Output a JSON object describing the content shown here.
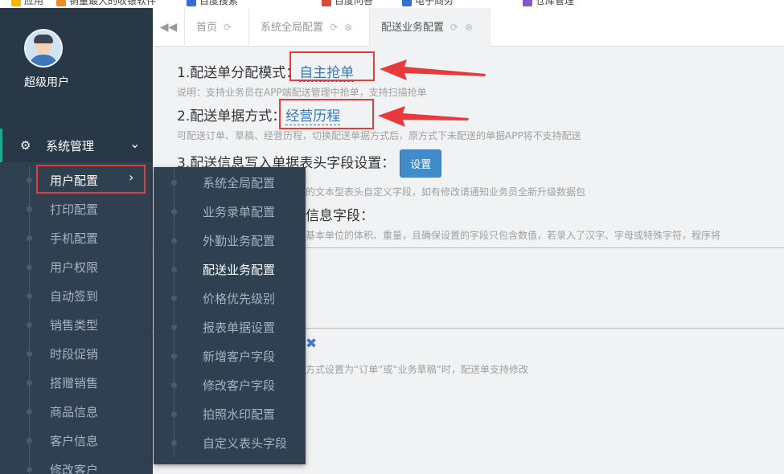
{
  "browser": {
    "bookmarks": [
      {
        "label": "应用",
        "color": "#f4b400"
      },
      {
        "label": "销量最大的收银软件",
        "color": "#f08a24"
      },
      {
        "label": "百度搜索",
        "color": "#2f6fd6"
      },
      {
        "label": "百度问答",
        "color": "#d84a3b"
      },
      {
        "label": "电子商务",
        "color": "#2f6fd6"
      },
      {
        "label": "仓库管理",
        "color": "#7c5cc4"
      }
    ]
  },
  "sidebar": {
    "username": "超级用户",
    "group": {
      "label": "系统管理",
      "icon": "gears-icon",
      "chevron": "chevron-down-icon"
    },
    "items": [
      {
        "label": "用户配置",
        "active": true
      },
      {
        "label": "打印配置"
      },
      {
        "label": "手机配置"
      },
      {
        "label": "用户权限"
      },
      {
        "label": "自动签到"
      },
      {
        "label": "销售类型"
      },
      {
        "label": "时段促销"
      },
      {
        "label": "搭赠销售"
      },
      {
        "label": "商品信息"
      },
      {
        "label": "客户信息"
      },
      {
        "label": "修改客户"
      }
    ]
  },
  "flyout": {
    "items": [
      {
        "label": "系统全局配置"
      },
      {
        "label": "业务录单配置"
      },
      {
        "label": "外勤业务配置"
      },
      {
        "label": "配送业务配置",
        "active": true
      },
      {
        "label": "价格优先级别"
      },
      {
        "label": "报表单据设置"
      },
      {
        "label": "新增客户字段"
      },
      {
        "label": "修改客户字段"
      },
      {
        "label": "拍照水印配置"
      },
      {
        "label": "自定义表头字段"
      }
    ]
  },
  "tabs": [
    {
      "label": "首页"
    },
    {
      "label": "系统全局配置"
    },
    {
      "label": "配送业务配置",
      "active": true
    }
  ],
  "content": {
    "s1": {
      "label": "1.配送单分配模式：",
      "value": "自主抢单",
      "note": "说明：支持业务员在APP端配送管理中抢单，支持扫描抢单"
    },
    "s2": {
      "label": "2.配送单据方式：",
      "value": "经营历程",
      "note": "可配送订单、草稿、经营历程，切换配送单据方式后，原方式下未配送的单据APP将不支持配送"
    },
    "s3": {
      "label": "3.配送信息写入单据表头字段设置：",
      "button": "设置",
      "note": "的文本型表头自定义字段，如有修改请通知业务员全新升级数据包"
    },
    "s4": {
      "label": "信息字段：",
      "note": "基本单位的体积、重量，且确保设置的字段只包含数值，若录入了汉字、字母或特殊字符，程序将"
    },
    "s5": {
      "note": "方式设置为“订单”或“业务草稿”时，配送单支持修改"
    }
  }
}
